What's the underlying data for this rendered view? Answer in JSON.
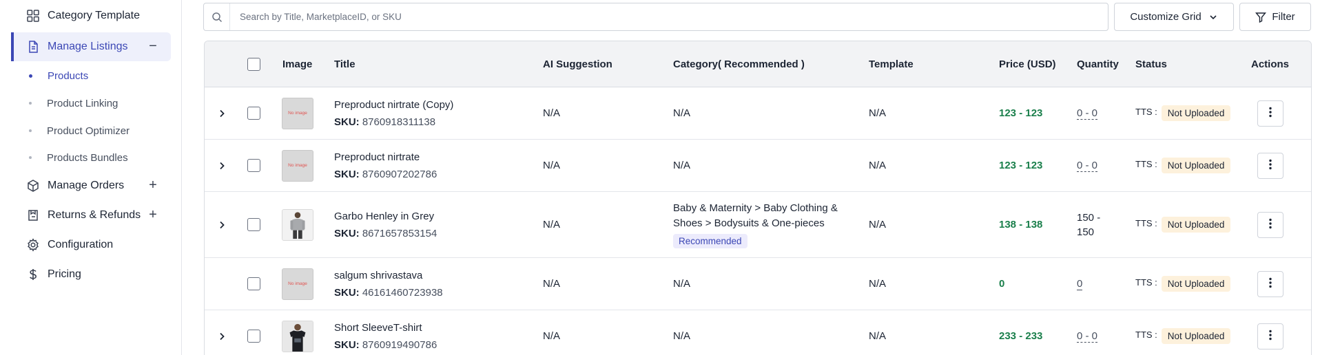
{
  "sidebar": {
    "items": [
      {
        "label": "Category Template",
        "icon": "grid-icon"
      },
      {
        "label": "Manage Listings",
        "icon": "document-icon",
        "toggle": "−"
      },
      {
        "label": "Manage Orders",
        "icon": "box-icon",
        "toggle": "+"
      },
      {
        "label": "Returns & Refunds",
        "icon": "return-icon",
        "toggle": "+"
      },
      {
        "label": "Configuration",
        "icon": "gear-icon"
      },
      {
        "label": "Pricing",
        "icon": "dollar-icon"
      }
    ],
    "sub_items": [
      "Products",
      "Product Linking",
      "Product Optimizer",
      "Products Bundles"
    ]
  },
  "toolbar": {
    "search_placeholder": "Search by Title, MarketplaceID, or SKU",
    "customize_label": "Customize Grid",
    "filter_label": "Filter"
  },
  "table": {
    "headers": {
      "image": "Image",
      "title": "Title",
      "ai": "AI Suggestion",
      "category": "Category( Recommended )",
      "template": "Template",
      "price": "Price (USD)",
      "quantity": "Quantity",
      "status": "Status",
      "actions": "Actions"
    },
    "sku_label": "SKU:",
    "no_image_text": "No image",
    "rows": [
      {
        "title": "Preproduct nirtrate (Copy)",
        "sku": "8760918311138",
        "ai": "N/A",
        "category": "N/A",
        "template": "N/A",
        "price": "123 - 123",
        "quantity": "0 - 0",
        "tts": "TTS :",
        "status": "Not Uploaded"
      },
      {
        "title": "Preproduct nirtrate",
        "sku": "8760907202786",
        "ai": "N/A",
        "category": "N/A",
        "template": "N/A",
        "price": "123 - 123",
        "quantity": "0 - 0",
        "tts": "TTS :",
        "status": "Not Uploaded"
      },
      {
        "title": "Garbo Henley in Grey",
        "sku": "8671657853154",
        "ai": "N/A",
        "category": "Baby & Maternity > Baby Clothing & Shoes > Bodysuits & One-pieces",
        "category_badge": "Recommended",
        "template": "N/A",
        "price": "138 - 138",
        "quantity": "150 - 150",
        "tts": "TTS :",
        "status": "Not Uploaded"
      },
      {
        "title": "salgum shrivastava",
        "sku": "46161460723938",
        "ai": "N/A",
        "category": "N/A",
        "template": "N/A",
        "price": "0",
        "quantity": "0",
        "tts": "TTS :",
        "status": "Not Uploaded"
      },
      {
        "title": "Short SleeveT-shirt",
        "sku": "8760919490786",
        "ai": "N/A",
        "category": "N/A",
        "template": "N/A",
        "price": "233 - 233",
        "quantity": "0 - 0",
        "tts": "TTS :",
        "status": "Not Uploaded"
      }
    ]
  },
  "colors": {
    "accent": "#3b47b5",
    "price_green": "#1a7f4b",
    "status_badge_bg": "#fdf1dc"
  }
}
